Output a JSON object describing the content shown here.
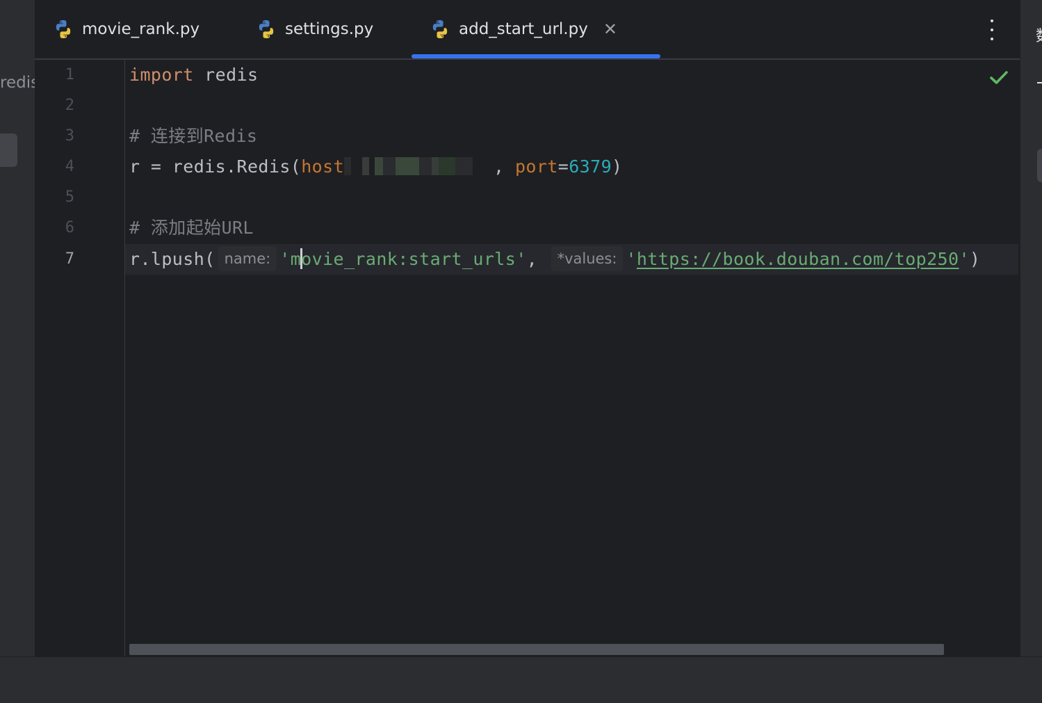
{
  "left_panel": {
    "fragment_text": "redis"
  },
  "tabs": [
    {
      "label": "movie_rank.py",
      "icon": "python-icon",
      "active": false
    },
    {
      "label": "settings.py",
      "icon": "python-icon",
      "active": false
    },
    {
      "label": "add_start_url.py",
      "icon": "python-icon",
      "active": true,
      "close_symbol": "✕"
    }
  ],
  "editor": {
    "current_line": 7,
    "line_numbers": [
      "1",
      "2",
      "3",
      "4",
      "5",
      "6",
      "7"
    ],
    "code": {
      "line1": {
        "keyword": "import",
        "module": " redis"
      },
      "line3": {
        "comment": "# 连接到Redis"
      },
      "line4": {
        "prefix": "r = redis.Redis(",
        "param_host": "host",
        "sep": ", ",
        "param_port": "port",
        "eq": "=",
        "port_value": "6379",
        "close": ")"
      },
      "line6": {
        "comment": "# 添加起始URL"
      },
      "line7": {
        "prefix": "r.lpush(",
        "hint_name": "name:",
        "str1_open": "'m",
        "str1_rest": "ovie_rank:start_urls'",
        "comma": ", ",
        "hint_values": "*values:",
        "str2_quote_open": "'",
        "str2_url": "https://book.douban.com/top250",
        "str2_quote_close": "'",
        "close": ")"
      }
    },
    "inspection_status_icon": "check-icon",
    "colors": {
      "keyword": "#cf8e6d",
      "parameter": "#c57633",
      "number": "#2aacb8",
      "string": "#6aab73",
      "comment": "#7a7e85",
      "tab_underline": "#3574f0",
      "check": "#5fb865"
    }
  },
  "right_panel": {
    "fragment_glyph": "数"
  }
}
